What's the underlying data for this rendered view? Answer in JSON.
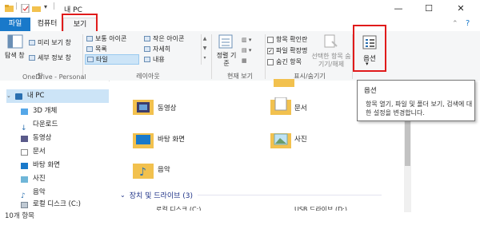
{
  "titlebar": {
    "title": "내 PC",
    "minimize": "—",
    "maximize": "☐",
    "close": "✕"
  },
  "tabs": {
    "file": "파일",
    "computer": "컴퓨터",
    "view": "보기"
  },
  "ribbon": {
    "pane_group": {
      "navigation_pane": "탐색 창",
      "preview_pane": "미리 보기 창",
      "details_pane": "세부 정보 창",
      "label": "창"
    },
    "layout_group": {
      "items": [
        "보통 아이콘",
        "작은 아이콘",
        "목록",
        "자세히",
        "타일",
        "내용"
      ],
      "label": "레이아웃"
    },
    "current_view_group": {
      "sort_by": "정렬 기준",
      "label": "현재 보기"
    },
    "show_hide_group": {
      "item_checkboxes": "항목 확인란",
      "file_extensions": "파일 확장명",
      "hidden_items": "숨긴 항목",
      "hide_selected": "선택한 항목 숨기기/해제",
      "label": "표시/숨기기"
    },
    "options": {
      "label": "옵션"
    }
  },
  "nav": {
    "cut_item": "OneDrive - Personal",
    "items": [
      "내 PC",
      "3D 개체",
      "다운로드",
      "동영상",
      "문서",
      "바탕 화면",
      "사진",
      "음악",
      "로컬 디스크 (C:)"
    ]
  },
  "status": {
    "count": "10개 항목"
  },
  "content": {
    "folders": [
      "동영상",
      "문서",
      "바탕 화면",
      "사진",
      "음악"
    ],
    "drives_header": "장치 및 드라이브 (3)",
    "drives": [
      "로컬 디스크 (C:)",
      "USB 드라이브 (D:)"
    ]
  },
  "tooltip": {
    "title": "옵션",
    "description": "항목 열기, 파일 및 폴더 보기, 검색에 대한 설정을 변경합니다."
  },
  "colors": {
    "accent": "#1979ca",
    "highlight": "#e01b1b",
    "selected": "#cce4f7",
    "folder": "#f2c14e"
  }
}
